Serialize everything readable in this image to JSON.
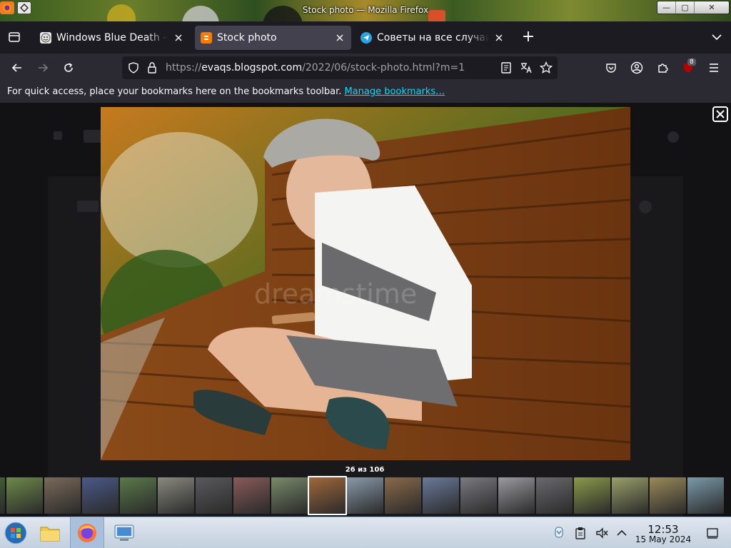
{
  "window": {
    "title": "Stock photo — Mozilla Firefox",
    "controls": {
      "minimize": "—",
      "maximize": "▢",
      "close": "✕"
    }
  },
  "tabs": [
    {
      "label": "Windows Blue Death - Te",
      "favicon": "face-favicon-icon",
      "active": false
    },
    {
      "label": "Stock photo",
      "favicon": "blogger-favicon-icon",
      "active": true
    },
    {
      "label": "Советы на все случаи ж",
      "favicon": "telegram-favicon-icon",
      "active": false
    }
  ],
  "tab_controls": {
    "new_tab": "+",
    "list_all": "chevron-down-icon"
  },
  "navbar": {
    "url_prefix": "https://",
    "url_host": "evaqs.blogspot.com",
    "url_path": "/2022/06/stock-photo.html?m=1",
    "extension_badge": "8"
  },
  "bookmarks": {
    "hint": "For quick access, place your bookmarks here on the bookmarks toolbar.",
    "manage_link": "Manage bookmarks…"
  },
  "lightbox": {
    "counter": "26 из 106",
    "close_icon": "close-icon",
    "watermark": "dreamstime",
    "selected_thumb_index": 9
  },
  "thumbnails": [
    {
      "color": "#4a6a3a"
    },
    {
      "color": "#6d8a4a"
    },
    {
      "color": "#7a6a5a"
    },
    {
      "color": "#4a5a8a"
    },
    {
      "color": "#5a7a4a"
    },
    {
      "color": "#8a8a80"
    },
    {
      "color": "#5a5a5e"
    },
    {
      "color": "#8a5a5a"
    },
    {
      "color": "#7a8a6a"
    },
    {
      "color": "#a0683a"
    },
    {
      "color": "#8a9aaa"
    },
    {
      "color": "#8a6a4a"
    },
    {
      "color": "#6a7a9a"
    },
    {
      "color": "#7a7a80"
    },
    {
      "color": "#9a9aa0"
    },
    {
      "color": "#6a6a6e"
    },
    {
      "color": "#8a9a4a"
    },
    {
      "color": "#9aa06a"
    },
    {
      "color": "#9a8a5a"
    },
    {
      "color": "#7a9aaa"
    }
  ],
  "taskbar": {
    "time": "12:53",
    "date": "15 May 2024"
  },
  "colors": {
    "accent_link": "#00ddff",
    "tab_active": "#42414d",
    "toolbar": "#2b2a33",
    "tabstrip": "#1c1b22",
    "taskbar": "#dfe6ef"
  }
}
